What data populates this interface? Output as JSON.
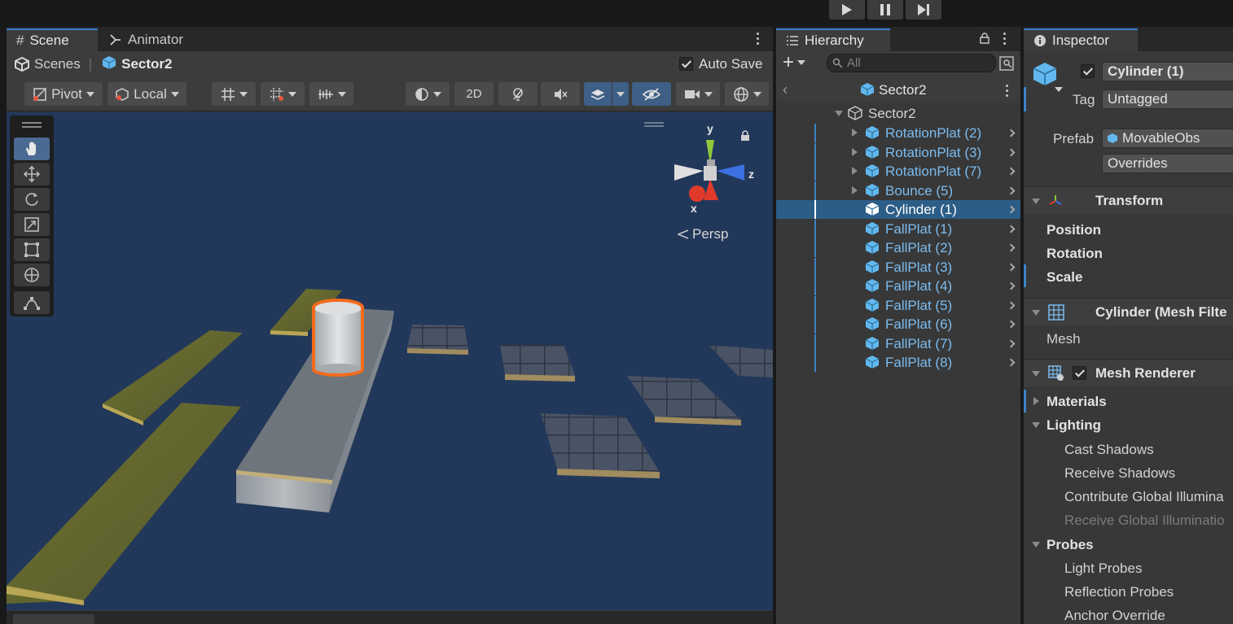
{
  "playbar": {
    "buttons": [
      "play",
      "pause",
      "step"
    ]
  },
  "scene_panel": {
    "tabs": [
      "Scene",
      "Animator"
    ],
    "breadcrumb": {
      "root": "Scenes",
      "current": "Sector2"
    },
    "auto_save_label": "Auto Save",
    "toolbar": {
      "pivot": "Pivot",
      "local": "Local",
      "two_d": "2D"
    },
    "gizmo": {
      "y": "y",
      "z": "z",
      "x": "x",
      "projection": "Persp"
    }
  },
  "hierarchy": {
    "tab": "Hierarchy",
    "search_placeholder": "All",
    "scene_name": "Sector2",
    "root_object": "Sector2",
    "items": [
      {
        "label": "RotationPlat (2)",
        "expandable": true
      },
      {
        "label": "RotationPlat (3)",
        "expandable": true
      },
      {
        "label": "RotationPlat (7)",
        "expandable": true
      },
      {
        "label": "Bounce (5)",
        "expandable": true
      },
      {
        "label": "Cylinder (1)",
        "expandable": false,
        "selected": true
      },
      {
        "label": "FallPlat (1)",
        "expandable": false
      },
      {
        "label": "FallPlat (2)",
        "expandable": false
      },
      {
        "label": "FallPlat (3)",
        "expandable": false
      },
      {
        "label": "FallPlat (4)",
        "expandable": false
      },
      {
        "label": "FallPlat (5)",
        "expandable": false
      },
      {
        "label": "FallPlat (6)",
        "expandable": false
      },
      {
        "label": "FallPlat (7)",
        "expandable": false
      },
      {
        "label": "FallPlat (8)",
        "expandable": false
      }
    ]
  },
  "inspector": {
    "tab": "Inspector",
    "object_name": "Cylinder (1)",
    "tag_label": "Tag",
    "tag_value": "Untagged",
    "prefab_label": "Prefab",
    "prefab_value": "MovableObs",
    "overrides_label": "Overrides",
    "transform": {
      "title": "Transform",
      "position": "Position",
      "rotation": "Rotation",
      "scale": "Scale"
    },
    "mesh_filter": {
      "title": "Cylinder (Mesh Filte",
      "mesh_label": "Mesh"
    },
    "mesh_renderer": {
      "title": "Mesh Renderer",
      "materials": "Materials",
      "lighting": "Lighting",
      "cast_shadows": "Cast Shadows",
      "receive_shadows": "Receive Shadows",
      "contribute_gi": "Contribute Global Illumina",
      "receive_gi": "Receive Global Illuminatio",
      "probes": "Probes",
      "light_probes": "Light Probes",
      "reflection_probes": "Reflection Probes",
      "anchor_override": "Anchor Override"
    }
  },
  "colors": {
    "accent": "#3a7fd0",
    "selection": "#2c5d87",
    "prefab_text": "#7bbcf0",
    "viewport_bg": "#22385a"
  }
}
